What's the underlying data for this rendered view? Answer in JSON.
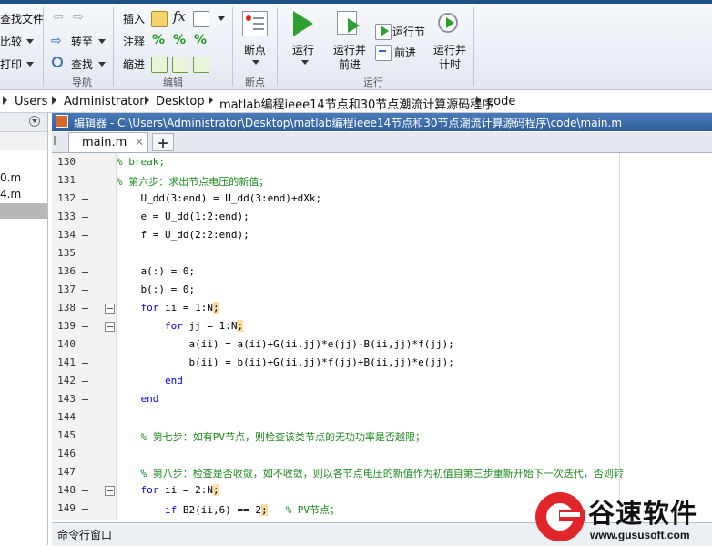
{
  "toolbar": {
    "file_group": {
      "find_files": "查找文件",
      "compare": "比较",
      "print": "打印"
    },
    "navigate_group": {
      "label": "导航",
      "goto": "转至",
      "find": "查找"
    },
    "edit_group": {
      "label": "编辑",
      "insert": "插入",
      "comment": "注释",
      "indent": "缩进"
    },
    "breakpoints_group": {
      "label": "断点",
      "breakpoints": "断点"
    },
    "run_group": {
      "label": "运行",
      "run": "运行",
      "run_and_advance_1": "运行并",
      "run_and_advance_2": "前进",
      "run_section": "运行节",
      "advance": "前进",
      "run_and_time_1": "运行并",
      "run_and_time_2": "计时"
    }
  },
  "breadcrumb": [
    "Users",
    "Administrator",
    "Desktop",
    "matlab编程ieee14节点和30节点潮流计算源码程序",
    "code"
  ],
  "left_panel": {
    "files": [
      "0.m",
      "4.m"
    ]
  },
  "editor": {
    "title": "编辑器 - C:\\Users\\Administrator\\Desktop\\matlab编程ieee14节点和30节点潮流计算源码程序\\code\\main.m",
    "tab": "main.m",
    "add_tab": "+",
    "lines": [
      {
        "n": "130",
        "dash": false,
        "fold": false,
        "html": "<span class='cmt'>% break;</span>",
        "indent": 0
      },
      {
        "n": "131",
        "dash": false,
        "fold": false,
        "html": "<span class='cmt'>% 第六步：求出节点电压的新值；</span>",
        "indent": 0
      },
      {
        "n": "132",
        "dash": true,
        "fold": false,
        "html": "    U_dd(3:end) = U_dd(3:end)+dXk;",
        "indent": 0
      },
      {
        "n": "133",
        "dash": true,
        "fold": false,
        "html": "    e = U_dd(1:2:end);",
        "indent": 0
      },
      {
        "n": "134",
        "dash": true,
        "fold": false,
        "html": "    f = U_dd(2:2:end);",
        "indent": 0
      },
      {
        "n": "135",
        "dash": false,
        "fold": false,
        "html": "",
        "indent": 0
      },
      {
        "n": "136",
        "dash": true,
        "fold": false,
        "html": "    a(:) = 0;",
        "indent": 0
      },
      {
        "n": "137",
        "dash": true,
        "fold": false,
        "html": "    b(:) = 0;",
        "indent": 0
      },
      {
        "n": "138",
        "dash": true,
        "fold": true,
        "html": "    <span class='kw'>for</span> ii = 1:N<span class='hl'>;</span>",
        "indent": 0
      },
      {
        "n": "139",
        "dash": true,
        "fold": true,
        "html": "        <span class='kw'>for</span> jj = 1:N<span class='hl'>;</span>",
        "indent": 0
      },
      {
        "n": "140",
        "dash": true,
        "fold": false,
        "html": "            a(ii) = a(ii)+G(ii,jj)*e(jj)-B(ii,jj)*f(jj);",
        "indent": 0
      },
      {
        "n": "141",
        "dash": true,
        "fold": false,
        "html": "            b(ii) = b(ii)+G(ii,jj)*f(jj)+B(ii,jj)*e(jj);",
        "indent": 0
      },
      {
        "n": "142",
        "dash": true,
        "fold": false,
        "html": "        <span class='kw'>end</span>",
        "indent": 0
      },
      {
        "n": "143",
        "dash": true,
        "fold": false,
        "html": "    <span class='kw'>end</span>",
        "indent": 0
      },
      {
        "n": "144",
        "dash": false,
        "fold": false,
        "html": "",
        "indent": 0
      },
      {
        "n": "145",
        "dash": false,
        "fold": false,
        "html": "    <span class='cmt'>% 第七步：如有PV节点，则检查该类节点的无功功率是否越限；</span>",
        "indent": 0
      },
      {
        "n": "146",
        "dash": false,
        "fold": false,
        "html": "",
        "indent": 0
      },
      {
        "n": "147",
        "dash": false,
        "fold": false,
        "html": "    <span class='cmt'>% 第八步：检查是否收敛，如不收敛，则以各节点电压的新值作为初值自第三步重新开始下一次迭代，否则转</span>",
        "indent": 0
      },
      {
        "n": "148",
        "dash": true,
        "fold": true,
        "html": "    <span class='kw'>for</span> ii = 2:N<span class='hl'>;</span>",
        "indent": 0
      },
      {
        "n": "149",
        "dash": true,
        "fold": false,
        "html": "        <span class='kw'>if</span> B2(ii,6) == 2<span class='hl'>;</span>   <span class='cmt'>% PV节点；</span>",
        "indent": 0
      }
    ]
  },
  "command_window": {
    "label": "命令行窗口"
  },
  "watermark": {
    "brand": "谷速软件",
    "url": "www.gususoft.com"
  },
  "colors": {
    "title_bar": "#2e5e9c",
    "comment": "#1e8a1e",
    "keyword": "#0000ee",
    "watermark_red": "#e0262a"
  }
}
